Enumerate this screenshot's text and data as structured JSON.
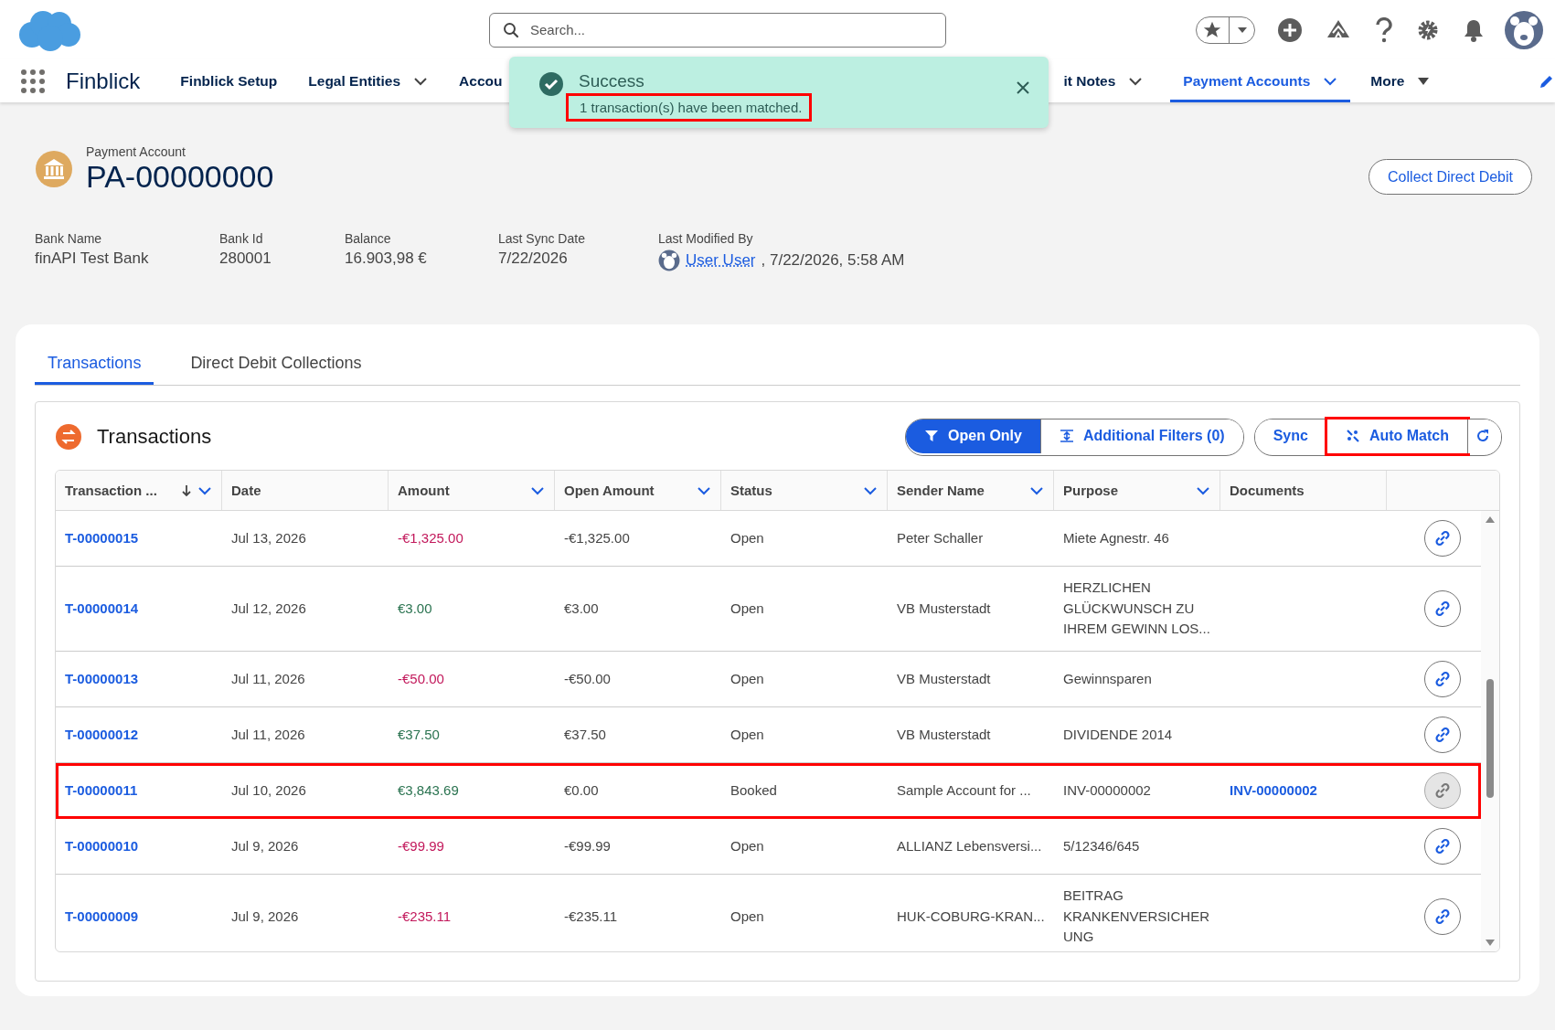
{
  "top_bar": {
    "search": {
      "placeholder": "Search..."
    }
  },
  "nav": {
    "app_name": "Finblick",
    "items": [
      {
        "kind": "link",
        "label": "Finblick Setup",
        "selected": false
      },
      {
        "kind": "menu",
        "label": "Legal Entities",
        "selected": false
      },
      {
        "kind": "link",
        "label": "Accou",
        "selected": false
      },
      {
        "kind": "menu",
        "label": "it Notes",
        "selected": false
      },
      {
        "kind": "menu",
        "label": "Payment Accounts",
        "selected": true
      },
      {
        "kind": "more",
        "label": "More",
        "selected": false
      }
    ]
  },
  "toast": {
    "title": "Success",
    "message": "1 transaction(s) have been matched.",
    "highlighted": true
  },
  "record": {
    "type_label": "Payment Account",
    "name": "PA-00000000",
    "action": "Collect Direct Debit",
    "fields": [
      {
        "kind": "text",
        "label": "Bank Name",
        "value": "finAPI Test Bank"
      },
      {
        "kind": "text",
        "label": "Bank Id",
        "value": "280001"
      },
      {
        "kind": "text",
        "label": "Balance",
        "value": "16.903,98 €"
      },
      {
        "kind": "text",
        "label": "Last Sync Date",
        "value": "7/22/2026"
      },
      {
        "kind": "user",
        "label": "Last Modified By",
        "value": "User User",
        "suffix": ", 7/22/2026, 5:58 AM"
      }
    ]
  },
  "tabs": [
    {
      "label": "Transactions",
      "selected": true
    },
    {
      "label": "Direct Debit Collections",
      "selected": false
    }
  ],
  "panel": {
    "title": "Transactions",
    "open_only": {
      "label": "Open Only",
      "selected": true
    },
    "additional_filters": "Additional Filters (0)",
    "sync": "Sync",
    "auto_match": {
      "label": "Auto Match",
      "highlighted": true
    },
    "columns": [
      {
        "label": "Transaction ...",
        "sorted": true,
        "menu": true
      },
      {
        "label": "Date",
        "sorted": false,
        "menu": false
      },
      {
        "label": "Amount",
        "sorted": false,
        "menu": true
      },
      {
        "label": "Open Amount",
        "sorted": false,
        "menu": true
      },
      {
        "label": "Status",
        "sorted": false,
        "menu": true
      },
      {
        "label": "Sender Name",
        "sorted": false,
        "menu": true
      },
      {
        "label": "Purpose",
        "sorted": false,
        "menu": true
      },
      {
        "label": "Documents",
        "sorted": false,
        "menu": false
      }
    ],
    "rows": [
      {
        "id": "T-00000015",
        "date": "Jul 13, 2026",
        "amount": "-€1,325.00",
        "debit": true,
        "open_amount": "-€1,325.00",
        "status": "Open",
        "sender": "Peter Schaller",
        "purpose": "Miete Agnestr. 46",
        "linked": false,
        "highlighted": false
      },
      {
        "id": "T-00000014",
        "date": "Jul 12, 2026",
        "amount": "€3.00",
        "debit": false,
        "open_amount": "€3.00",
        "status": "Open",
        "sender": "VB Musterstadt",
        "purpose": "HERZLICHEN GLÜCKWUNSCH ZU IHREM GEWINN LOS...",
        "linked": false,
        "highlighted": false
      },
      {
        "id": "T-00000013",
        "date": "Jul 11, 2026",
        "amount": "-€50.00",
        "debit": true,
        "open_amount": "-€50.00",
        "status": "Open",
        "sender": "VB Musterstadt",
        "purpose": "Gewinnsparen",
        "linked": false,
        "highlighted": false
      },
      {
        "id": "T-00000012",
        "date": "Jul 11, 2026",
        "amount": "€37.50",
        "debit": false,
        "open_amount": "€37.50",
        "status": "Open",
        "sender": "VB Musterstadt",
        "purpose": "DIVIDENDE 2014",
        "linked": false,
        "highlighted": false
      },
      {
        "id": "T-00000011",
        "date": "Jul 10, 2026",
        "amount": "€3,843.69",
        "debit": false,
        "open_amount": "€0.00",
        "status": "Booked",
        "sender": "Sample Account for ...",
        "purpose": "INV-00000002",
        "document": "INV-00000002",
        "linked": true,
        "highlighted": true
      },
      {
        "id": "T-00000010",
        "date": "Jul 9, 2026",
        "amount": "-€99.99",
        "debit": true,
        "open_amount": "-€99.99",
        "status": "Open",
        "sender": "ALLIANZ Lebensversi...",
        "purpose": "5/12346/645",
        "linked": false,
        "highlighted": false
      },
      {
        "id": "T-00000009",
        "date": "Jul 9, 2026",
        "amount": "-€235.11",
        "debit": true,
        "open_amount": "-€235.11",
        "status": "Open",
        "sender": "HUK-COBURG-KRAN...",
        "purpose": "BEITRAG KRANKENVERSICHER UNG",
        "linked": false,
        "highlighted": false
      }
    ]
  }
}
